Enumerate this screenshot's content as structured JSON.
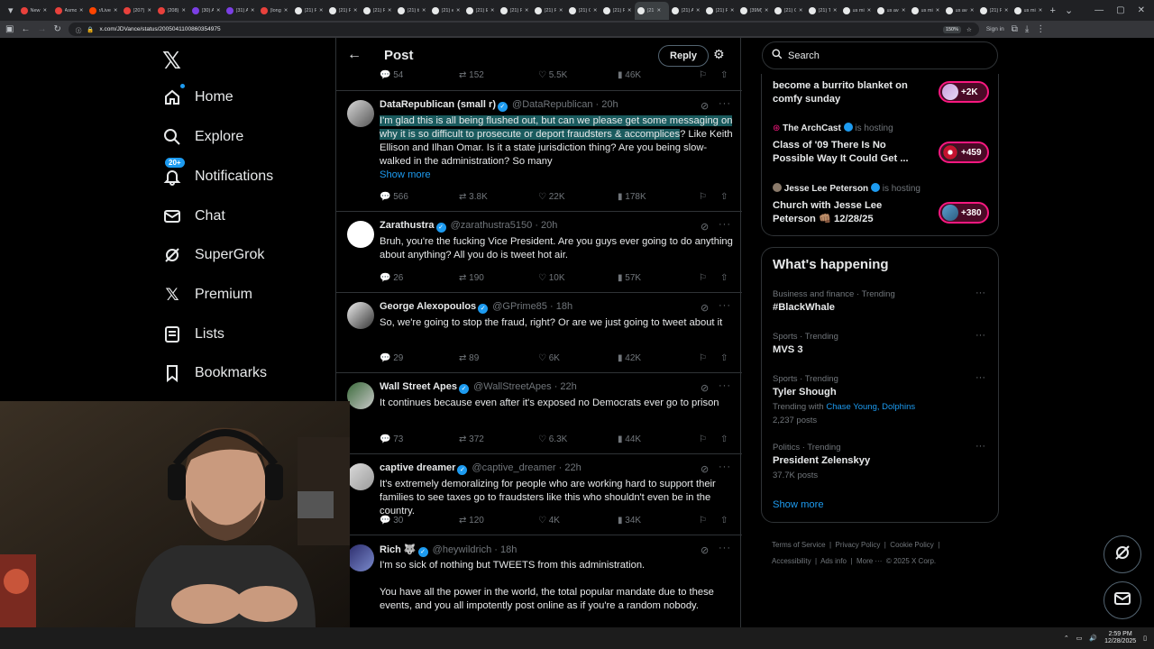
{
  "browser": {
    "tabs": [
      {
        "label": "New",
        "color": "#e8413c"
      },
      {
        "label": "Asmo",
        "color": "#e8413c"
      },
      {
        "label": "r/Live",
        "color": "#ff4500"
      },
      {
        "label": "(207)",
        "color": "#e8413c"
      },
      {
        "label": "(208)",
        "color": "#e8413c"
      },
      {
        "label": "(30) A",
        "color": "#7b3fe4"
      },
      {
        "label": "(31) A",
        "color": "#7b3fe4"
      },
      {
        "label": "(long",
        "color": "#e8413c"
      },
      {
        "label": "(21) F",
        "color": "#e7e9ea"
      },
      {
        "label": "(21) F",
        "color": "#e7e9ea"
      },
      {
        "label": "(21) F",
        "color": "#e7e9ea"
      },
      {
        "label": "(21) ti",
        "color": "#e7e9ea"
      },
      {
        "label": "(21) e",
        "color": "#e7e9ea"
      },
      {
        "label": "(21) E",
        "color": "#e7e9ea"
      },
      {
        "label": "(21) F",
        "color": "#e7e9ea"
      },
      {
        "label": "(21) F",
        "color": "#e7e9ea"
      },
      {
        "label": "(21) G",
        "color": "#e7e9ea"
      },
      {
        "label": "(21) F",
        "color": "#e7e9ea"
      },
      {
        "label": "(21",
        "color": "#e7e9ea"
      },
      {
        "label": "(21) A",
        "color": "#e7e9ea"
      },
      {
        "label": "(21) F",
        "color": "#e7e9ea"
      },
      {
        "label": "(39M)",
        "color": "#e7e9ea"
      },
      {
        "label": "(21) C",
        "color": "#e7e9ea"
      },
      {
        "label": "(21) T",
        "color": "#e7e9ea"
      },
      {
        "label": "us mi",
        "color": "#e7e9ea"
      },
      {
        "label": "us ave",
        "color": "#e7e9ea"
      },
      {
        "label": "us mi",
        "color": "#e7e9ea"
      },
      {
        "label": "us ave",
        "color": "#e7e9ea"
      },
      {
        "label": "(21) F",
        "color": "#e7e9ea"
      },
      {
        "label": "us mi",
        "color": "#e7e9ea"
      }
    ],
    "url": "x.com/JDVance/status/2005041100860354975",
    "zoom": "150%",
    "signin": "Sign in"
  },
  "nav": {
    "items": [
      {
        "label": "Home"
      },
      {
        "label": "Explore"
      },
      {
        "label": "Notifications",
        "badge": "20+"
      },
      {
        "label": "Chat"
      },
      {
        "label": "SuperGrok"
      },
      {
        "label": "Premium"
      },
      {
        "label": "Lists"
      },
      {
        "label": "Bookmarks"
      }
    ]
  },
  "post": {
    "title": "Post",
    "reply_label": "Reply",
    "top_stats": {
      "replies": "54",
      "reposts": "152",
      "likes": "5.5K",
      "views": "46K"
    }
  },
  "tweets": [
    {
      "name": "DataRepublican (small r)",
      "handle": "@DataRepublican",
      "time": "20h",
      "text_highlight": "I'm glad this is all being flushed out, but can we please get some messaging on why it is so difficult to prosecute or deport fraudsters & accomplices",
      "text_rest": "? Like Keith Ellison and Ilhan Omar. Is it a state jurisdiction thing? Are you being slow-walked in the administration? So many",
      "show_more": "Show more",
      "replies": "566",
      "reposts": "3.8K",
      "likes": "22K",
      "views": "178K"
    },
    {
      "name": "Zarathustra",
      "handle": "@zarathustra5150",
      "time": "20h",
      "text": "Bruh, you're the fucking Vice President. Are you guys ever going to do anything about anything? All you do is tweet hot air.",
      "replies": "26",
      "reposts": "190",
      "likes": "10K",
      "views": "57K"
    },
    {
      "name": "George Alexopoulos",
      "handle": "@GPrime85",
      "time": "18h",
      "text": "So, we're going to stop the fraud, right? Or are we just going to tweet about it",
      "replies": "29",
      "reposts": "89",
      "likes": "6K",
      "views": "42K"
    },
    {
      "name": "Wall Street Apes",
      "handle": "@WallStreetApes",
      "time": "22h",
      "text": "It continues because even after it's exposed no Democrats ever go to prison",
      "replies": "73",
      "reposts": "372",
      "likes": "6.3K",
      "views": "44K"
    },
    {
      "name": "captive dreamer",
      "handle": "@captive_dreamer",
      "time": "22h",
      "text": "It's extremely demoralizing for people who are working hard to support their families to see taxes go to fraudsters like this who shouldn't even be in the country.",
      "replies": "30",
      "reposts": "120",
      "likes": "4K",
      "views": "34K"
    },
    {
      "name": "Rich 🐺",
      "handle": "@heywildrich",
      "time": "18h",
      "text": "I'm so sick of nothing but TWEETS from this administration.\n\nYou have all the power in the world, the total popular mandate due to these events, and you all impotently post online as if you're a random nobody."
    }
  ],
  "sidebar": {
    "search_placeholder": "Search",
    "spaces": [
      {
        "title": "become a burrito blanket on comfy sunday",
        "count": "+2K"
      },
      {
        "host": "The ArchCast",
        "hosting": "is hosting",
        "title": "Class of '09 There Is No Possible Way It Could Get ...",
        "count": "+459"
      },
      {
        "host": "Jesse Lee Peterson",
        "hosting": "is hosting",
        "title": "Church with Jesse Lee Peterson 👊🏽 12/28/25",
        "count": "+380"
      }
    ],
    "trends_title": "What's happening",
    "trends": [
      {
        "category": "Business and finance · Trending",
        "name": "#BlackWhale"
      },
      {
        "category": "Sports · Trending",
        "name": "MVS 3"
      },
      {
        "category": "Sports · Trending",
        "name": "Tyler Shough",
        "trending_with": "Trending with",
        "links": "Chase Young, Dolphins",
        "posts": "2,237 posts"
      },
      {
        "category": "Politics · Trending",
        "name": "President Zelenskyy",
        "posts": "37.7K posts"
      }
    ],
    "show_more": "Show more",
    "footer": {
      "line1": "Terms of Service  |  Privacy Policy  |  Cookie Policy  |",
      "line2": "Accessibility  |  Ads info  |  More ···  © 2025 X Corp."
    }
  },
  "taskbar": {
    "time": "2:59 PM",
    "date": "12/28/2025"
  }
}
